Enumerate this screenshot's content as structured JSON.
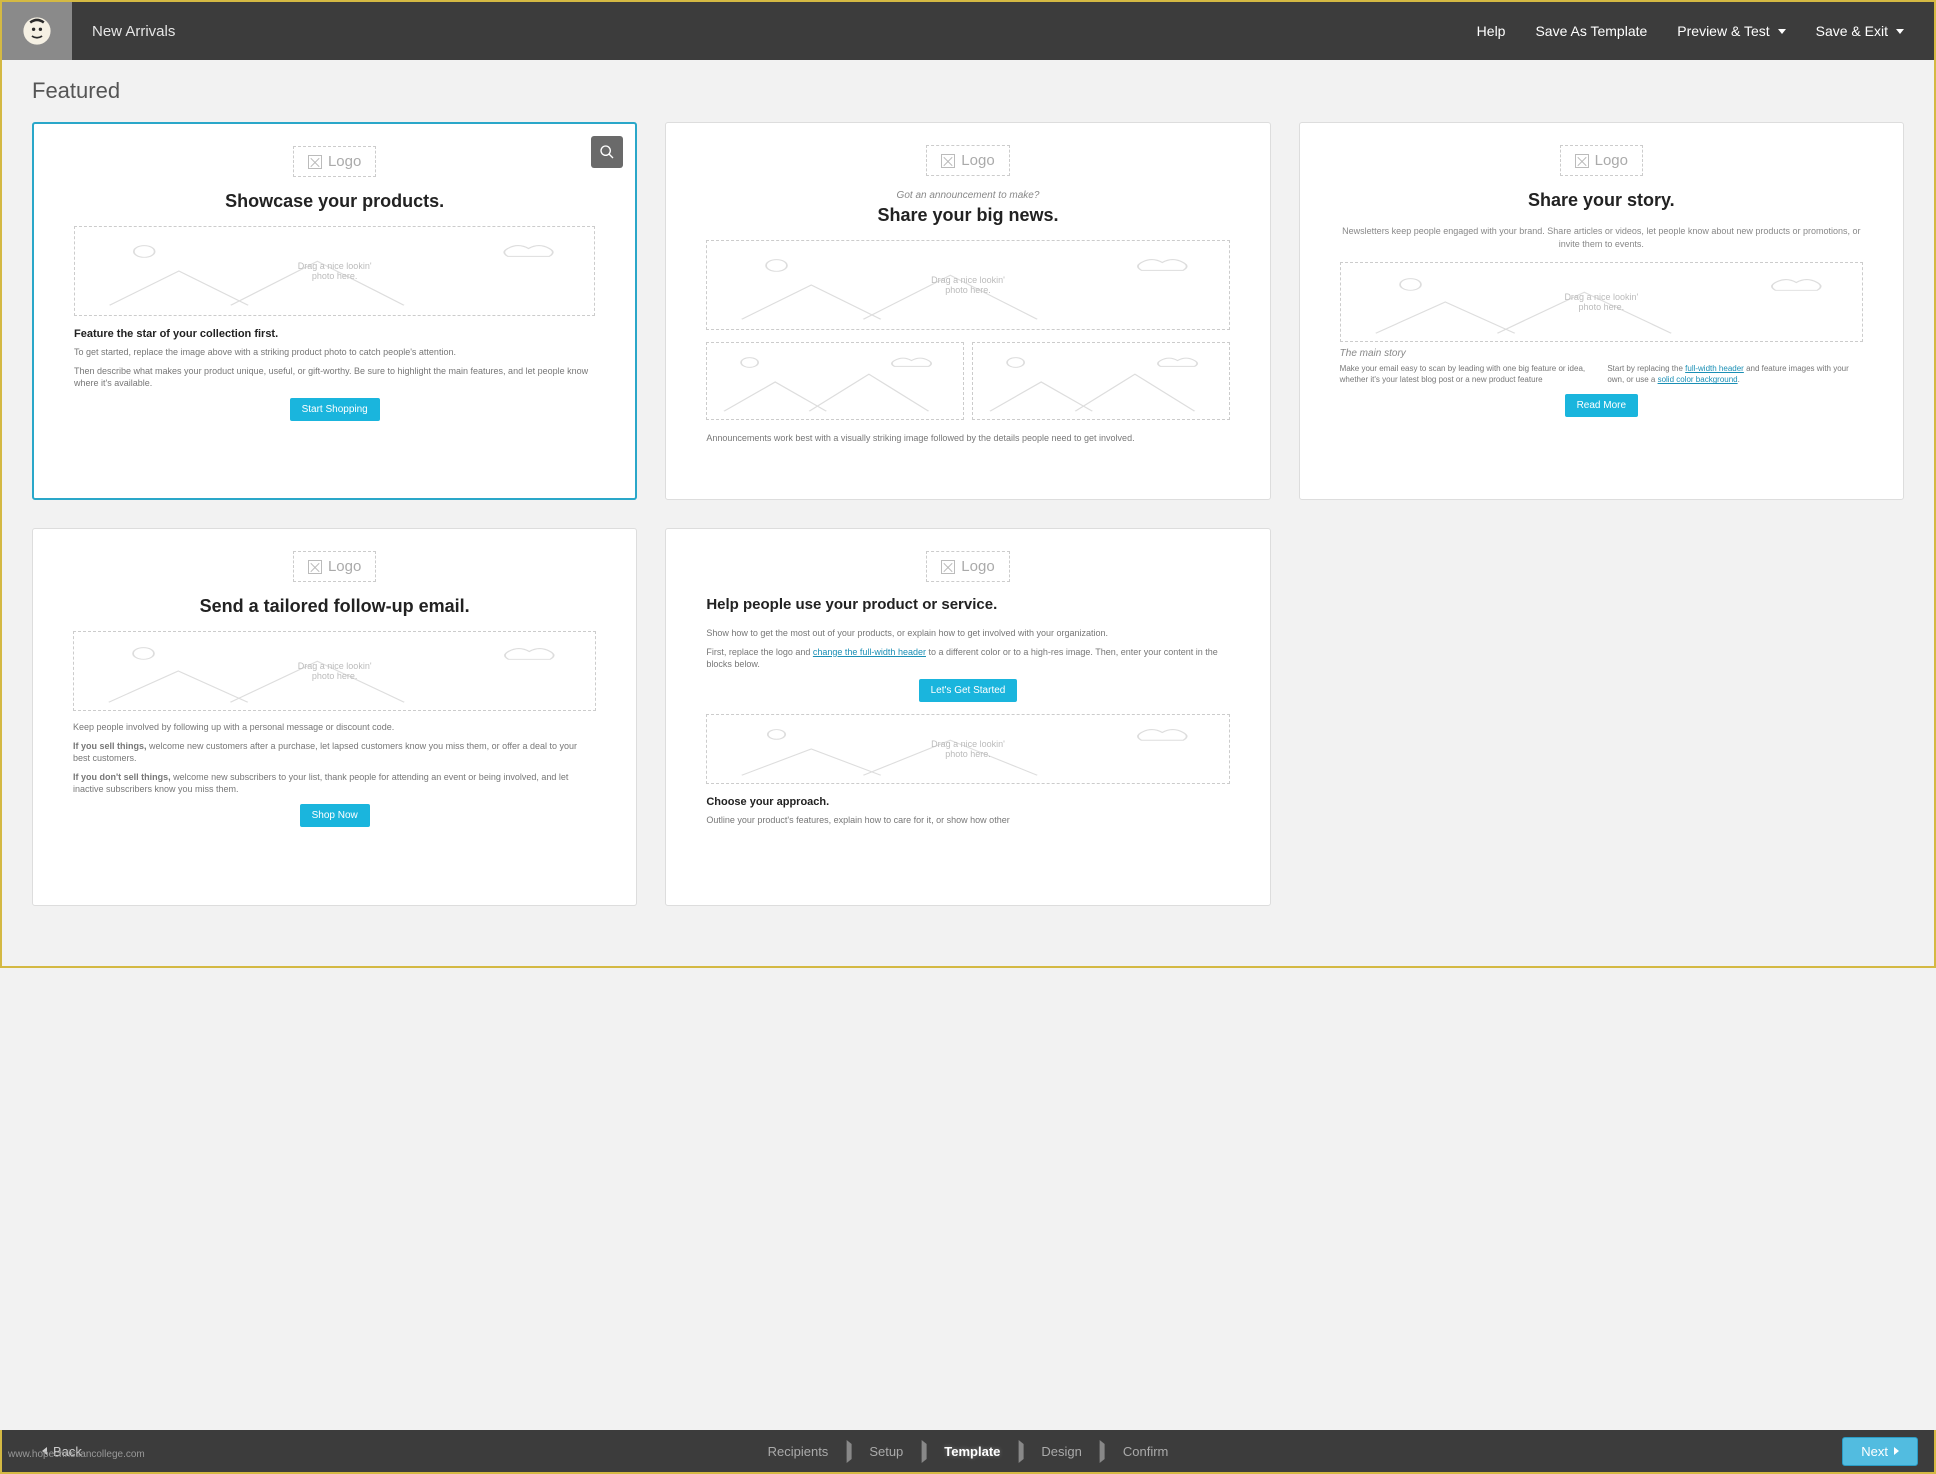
{
  "topbar": {
    "campaign_name": "New Arrivals",
    "help": "Help",
    "save_template": "Save As Template",
    "preview_test": "Preview & Test",
    "save_exit": "Save & Exit"
  },
  "section_title": "Featured",
  "logo_label": "Logo",
  "photo_placeholder": "Drag a nice lookin'\nphoto here.",
  "cards": [
    {
      "headline": "Showcase your products.",
      "body_title": "Feature the star of your collection first.",
      "p1": "To get started, replace the image above with a striking product photo to catch people's attention.",
      "p2": "Then describe what makes your product unique, useful, or gift-worthy. Be sure to highlight the main features, and let people know where it's available.",
      "cta": "Start Shopping"
    },
    {
      "pre": "Got an announcement to make?",
      "headline": "Share your big news.",
      "footer_text": "Announcements work best with a visually striking image followed by the details people need to get involved."
    },
    {
      "headline": "Share your story.",
      "sub": "Newsletters keep people engaged with your brand. Share articles or videos, let people know about new products or promotions, or invite them to events.",
      "story_title": "The main story",
      "col1": "Make your email easy to scan by leading with one big feature or idea, whether it's your latest blog post or a new product feature",
      "col2_a": "Start by replacing the ",
      "col2_link1": "full-width header",
      "col2_b": " and feature images with your own, or use a ",
      "col2_link2": "solid color background",
      "col2_c": ".",
      "cta": "Read More"
    },
    {
      "headline": "Send a tailored follow-up email.",
      "p1": "Keep people involved by following up with a personal message or discount code.",
      "p2a": "If you sell things,",
      "p2b": " welcome new customers after a purchase, let lapsed customers know you miss them, or offer a deal to your best customers.",
      "p3a": "If you don't sell things,",
      "p3b": " welcome new subscribers to your list, thank people for attending an event or being involved, and let inactive subscribers know you miss them.",
      "cta": "Shop Now"
    },
    {
      "headline": "Help people use your product or service.",
      "p1": "Show how to get the most out of your products, or explain how to get involved with your organization.",
      "p2a": "First, replace the logo and ",
      "p2link": "change the full-width header",
      "p2b": " to a different color or to a high-res image. Then, enter your content in the blocks below.",
      "cta": "Let's Get Started",
      "body_title": "Choose your approach.",
      "p3": "Outline your product's features, explain how to care for it, or show how other"
    }
  ],
  "bottombar": {
    "back": "Back",
    "steps": [
      "Recipients",
      "Setup",
      "Template",
      "Design",
      "Confirm"
    ],
    "active_step": 2,
    "next": "Next"
  },
  "watermark": "www.hopechristiancollege.com"
}
